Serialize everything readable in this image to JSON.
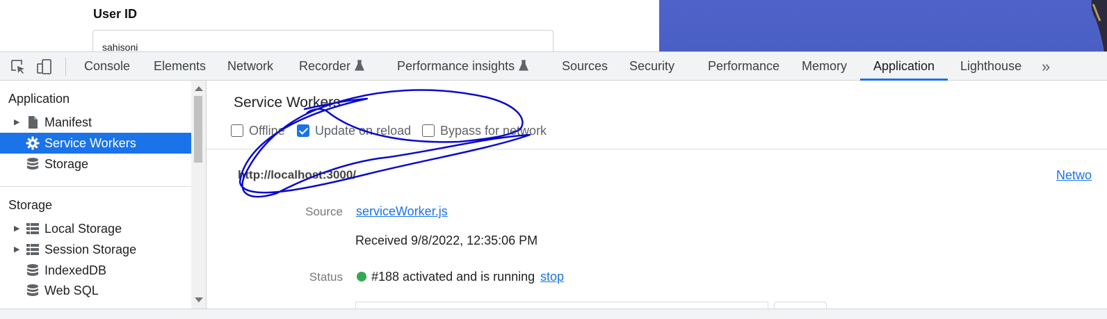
{
  "page": {
    "user_id_label": "User ID",
    "user_id_value": "sahisoni"
  },
  "toolbar": {
    "tabs": [
      {
        "label": "Console"
      },
      {
        "label": "Elements"
      },
      {
        "label": "Network"
      },
      {
        "label": "Recorder",
        "icon": "flask-icon"
      },
      {
        "label": "Performance insights",
        "icon": "flask-icon"
      },
      {
        "label": "Sources"
      },
      {
        "label": "Security"
      },
      {
        "label": "Performance"
      },
      {
        "label": "Memory"
      },
      {
        "label": "Application",
        "active": true
      },
      {
        "label": "Lighthouse"
      }
    ],
    "more_label": "»"
  },
  "sidebar": {
    "application_header": "Application",
    "application_items": [
      {
        "label": "Manifest",
        "icon": "file-icon",
        "expandable": true
      },
      {
        "label": "Service Workers",
        "icon": "gear-icon",
        "selected": true
      },
      {
        "label": "Storage",
        "icon": "database-icon"
      }
    ],
    "storage_header": "Storage",
    "storage_items": [
      {
        "label": "Local Storage",
        "icon": "grid-icon",
        "expandable": true
      },
      {
        "label": "Session Storage",
        "icon": "grid-icon",
        "expandable": true
      },
      {
        "label": "IndexedDB",
        "icon": "database-icon"
      },
      {
        "label": "Web SQL",
        "icon": "database-icon"
      }
    ]
  },
  "main": {
    "title": "Service Workers",
    "options": [
      {
        "label": "Offline",
        "checked": false
      },
      {
        "label": "Update on reload",
        "checked": true
      },
      {
        "label": "Bypass for network",
        "checked": false
      }
    ],
    "origin": "http://localhost:3000/",
    "network_link": "Netwo",
    "source_label": "Source",
    "source_file": "serviceWorker.js",
    "received": "Received 9/8/2022, 12:35:06 PM",
    "status_label": "Status",
    "status_text": "#188 activated and is running",
    "stop_label": "stop"
  },
  "colors": {
    "accent": "#1a73e8",
    "status_green": "#34a853",
    "annotation": "#0a0acc",
    "hero_blue": "#4e62c9"
  }
}
